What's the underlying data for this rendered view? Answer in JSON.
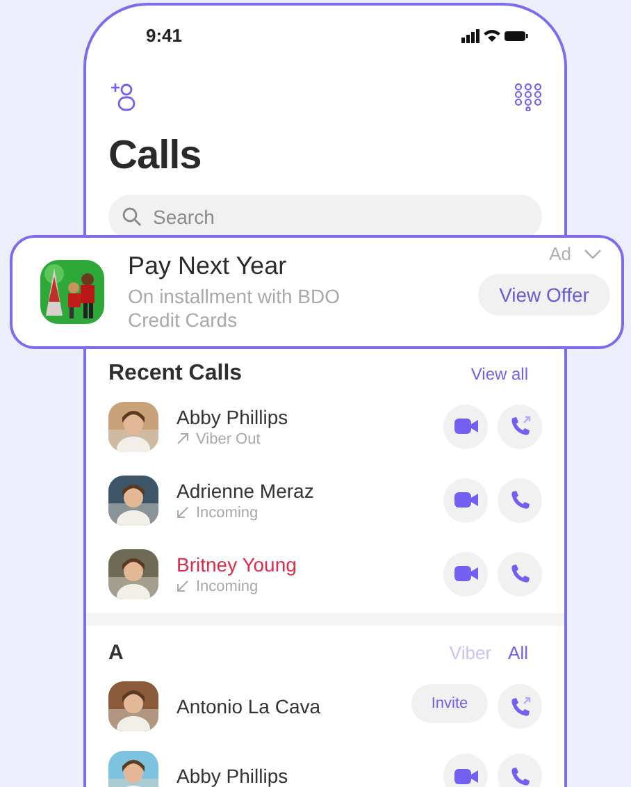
{
  "status_bar": {
    "time": "9:41"
  },
  "title": "Calls",
  "search": {
    "placeholder": "Search"
  },
  "ad": {
    "title": "Pay Next Year",
    "text": "On installment with BDO Credit Cards",
    "label": "Ad",
    "button": "View Offer"
  },
  "recent": {
    "heading": "Recent Calls",
    "link": "View all",
    "rows": [
      {
        "name": "Abby Phillips",
        "missed": false,
        "detail": "Viber Out",
        "kind": "outgoing",
        "actions": [
          {
            "kind": "video"
          },
          {
            "kind": "call_out"
          }
        ]
      },
      {
        "name": "Adrienne Meraz",
        "missed": false,
        "detail": "Incoming",
        "kind": "incoming",
        "actions": [
          {
            "kind": "video"
          },
          {
            "kind": "call"
          }
        ]
      },
      {
        "name": "Britney Young",
        "missed": true,
        "detail": "Incoming",
        "kind": "incoming",
        "actions": [
          {
            "kind": "video"
          },
          {
            "kind": "call"
          }
        ]
      }
    ]
  },
  "contacts": {
    "letter": "A",
    "filters": [
      {
        "label": "Viber",
        "selected": false
      },
      {
        "label": "All",
        "selected": true
      }
    ],
    "rows": [
      {
        "name": "Antonio La Cava",
        "actions": [
          {
            "kind": "invite",
            "label": "Invite"
          },
          {
            "kind": "call_out"
          }
        ]
      },
      {
        "name": "Abby Phillips",
        "actions": [
          {
            "kind": "video"
          },
          {
            "kind": "call"
          }
        ]
      }
    ]
  }
}
